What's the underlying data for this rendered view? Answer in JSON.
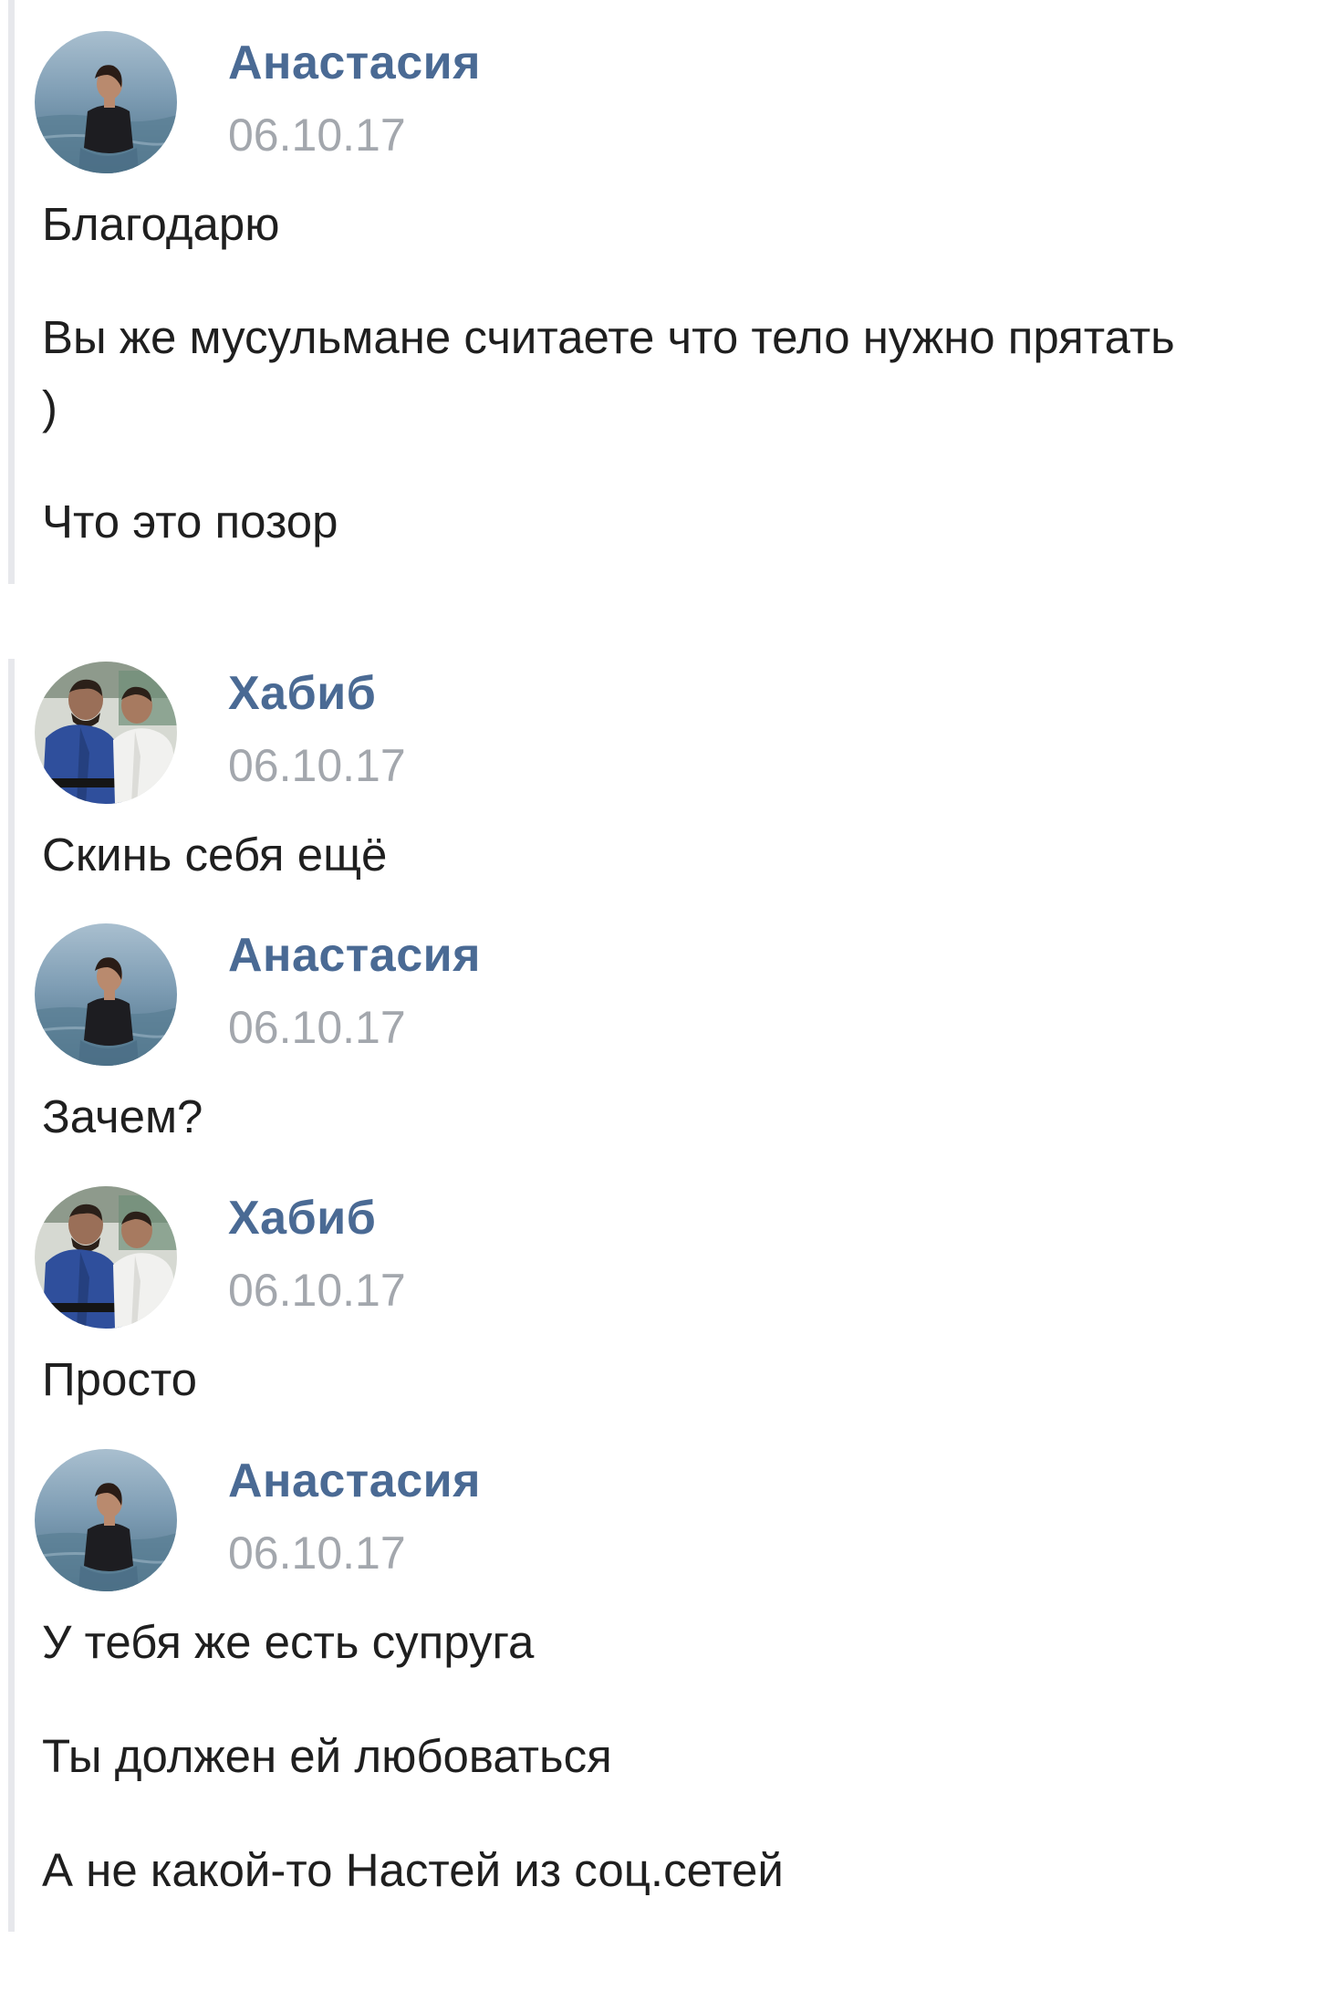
{
  "threads": [
    {
      "messages": [
        {
          "author": "Анастасия",
          "date": "06.10.17",
          "avatar_icon": "woman-sea-avatar",
          "lines": [
            "Благодарю",
            "Вы же мусульмане считаете что тело нужно прятать",
            ")",
            "Что это позор"
          ]
        }
      ]
    },
    {
      "messages": [
        {
          "author": "Хабиб",
          "date": "06.10.17",
          "avatar_icon": "two-men-kimono-avatar",
          "lines": [
            "Скинь себя ещё"
          ]
        },
        {
          "author": "Анастасия",
          "date": "06.10.17",
          "avatar_icon": "woman-sea-avatar",
          "lines": [
            "Зачем?"
          ]
        },
        {
          "author": "Хабиб",
          "date": "06.10.17",
          "avatar_icon": "two-men-kimono-avatar",
          "lines": [
            "Просто"
          ]
        },
        {
          "author": "Анастасия",
          "date": "06.10.17",
          "avatar_icon": "woman-sea-avatar",
          "lines": [
            "У тебя же есть супруга",
            "Ты должен ей любоваться",
            "А не какой-то Настей из соц.сетей"
          ]
        }
      ]
    }
  ],
  "colors": {
    "author_link": "#4a6a94",
    "date_text": "#a3a7ad",
    "body_text": "#1f1f1f",
    "thread_bar": "#e7e8ec"
  }
}
